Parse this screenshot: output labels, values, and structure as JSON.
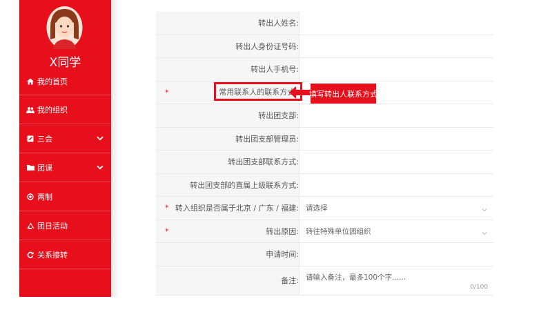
{
  "sidebar": {
    "user_name": "X同学",
    "items": [
      {
        "label": "我的首页",
        "icon": "home-icon",
        "has_chevron": false
      },
      {
        "label": "我的组织",
        "icon": "users-icon",
        "has_chevron": false
      },
      {
        "label": "三会",
        "icon": "edit-icon",
        "has_chevron": true
      },
      {
        "label": "团课",
        "icon": "folder-icon",
        "has_chevron": true
      },
      {
        "label": "两制",
        "icon": "target-icon",
        "has_chevron": false
      },
      {
        "label": "团日活动",
        "icon": "recycle-icon",
        "has_chevron": false
      },
      {
        "label": "关系接转",
        "icon": "refresh-icon",
        "has_chevron": false
      }
    ]
  },
  "form": {
    "rows": [
      {
        "label": "转出人姓名:"
      },
      {
        "label": "转出人身份证号码:"
      },
      {
        "label": "转出人手机号:"
      },
      {
        "label": "常用联系人的联系方式:",
        "required": "*"
      },
      {
        "label": "转出团支部:"
      },
      {
        "label": "转出团支部管理员:"
      },
      {
        "label": "转出团支部联系方式:"
      },
      {
        "label": "转出团支部的直属上级联系方式:"
      },
      {
        "label": "转入组织是否属于北京 / 广东 / 福建:",
        "required": "*",
        "placeholder": "请选择"
      },
      {
        "label": "转出原因:",
        "required": "*",
        "value": "转往特殊单位团组织"
      },
      {
        "label": "申请时间:"
      },
      {
        "label": "备注:",
        "placeholder": "请输入备注，最多100个字......",
        "counter": "0/100"
      }
    ]
  },
  "annotation": {
    "callout_text": "填写转出人联系方式",
    "color": "#e60f1b"
  },
  "colors": {
    "brand": "#e60f1b",
    "label_bg": "#f6f6f6"
  }
}
